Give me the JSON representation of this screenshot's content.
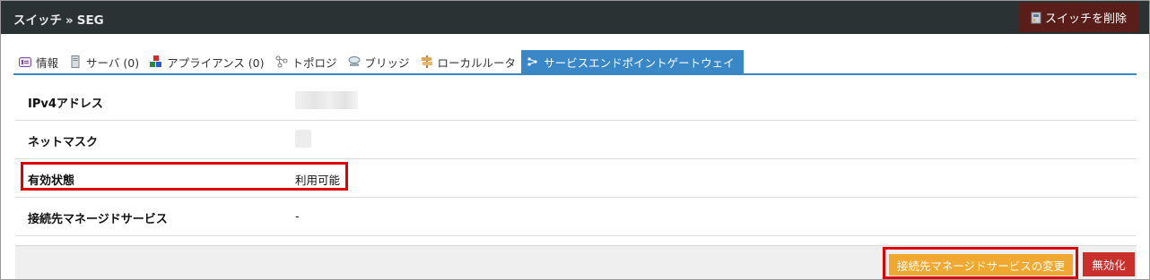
{
  "header": {
    "breadcrumb": [
      "スイッチ",
      "SEG"
    ],
    "breadcrumb_separator": "»",
    "delete_button_label": "スイッチを削除",
    "background_color": "#2b3234"
  },
  "tabs": [
    {
      "label": "情報",
      "icon": "info-icon",
      "active": false
    },
    {
      "label": "サーバ (0)",
      "icon": "server-icon",
      "active": false
    },
    {
      "label": "アプライアンス (0)",
      "icon": "appliance-icon",
      "active": false
    },
    {
      "label": "トポロジ",
      "icon": "topology-icon",
      "active": false
    },
    {
      "label": "ブリッジ",
      "icon": "bridge-icon",
      "active": false
    },
    {
      "label": "ローカルルータ",
      "icon": "router-icon",
      "active": false
    },
    {
      "label": "サービスエンドポイントゲートウェイ",
      "icon": "gateway-icon",
      "active": true
    }
  ],
  "details": {
    "ipv4_label": "IPv4アドレス",
    "netmask_label": "ネットマスク",
    "status_label": "有効状態",
    "status_value": "利用可能",
    "managed_service_label": "接続先マネージドサービス",
    "managed_service_value": "-"
  },
  "footer": {
    "change_service_label": "接続先マネージドサービスの変更",
    "disable_label": "無効化"
  },
  "colors": {
    "accent": "#3a87c8",
    "warning": "#f0a830",
    "danger": "#c9302c",
    "highlight": "#e00000"
  }
}
